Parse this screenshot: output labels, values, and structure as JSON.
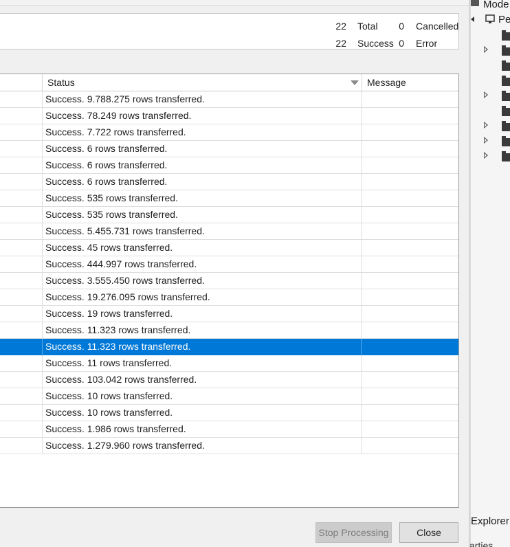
{
  "summary": {
    "total_count": "22",
    "total_label": "Total",
    "cancelled_count": "0",
    "cancelled_label": "Cancelled",
    "success_count": "22",
    "success_label": "Success",
    "error_count": "0",
    "error_label": "Error"
  },
  "grid": {
    "columns": [
      "",
      "Status",
      "Message"
    ],
    "rows": [
      {
        "status": "Success. 9.788.275 rows transferred.",
        "message": ""
      },
      {
        "status": "Success. 78.249 rows transferred.",
        "message": ""
      },
      {
        "status": "Success. 7.722 rows transferred.",
        "message": ""
      },
      {
        "status": "Success. 6 rows transferred.",
        "message": ""
      },
      {
        "status": "Success. 6 rows transferred.",
        "message": ""
      },
      {
        "status": "Success. 6 rows transferred.",
        "message": ""
      },
      {
        "status": "Success. 535 rows transferred.",
        "message": ""
      },
      {
        "status": "Success. 535 rows transferred.",
        "message": ""
      },
      {
        "status": "Success. 5.455.731 rows transferred.",
        "message": ""
      },
      {
        "status": "Success. 45 rows transferred.",
        "message": ""
      },
      {
        "status": "Success. 444.997 rows transferred.",
        "message": ""
      },
      {
        "status": "Success. 3.555.450 rows transferred.",
        "message": ""
      },
      {
        "status": "Success. 19.276.095 rows transferred.",
        "message": ""
      },
      {
        "status": "Success. 19 rows transferred.",
        "message": ""
      },
      {
        "status": "Success. 11.323 rows transferred.",
        "message": ""
      },
      {
        "status": "Success. 11.323 rows transferred.",
        "message": "",
        "selected": true
      },
      {
        "status": "Success. 11 rows transferred.",
        "message": ""
      },
      {
        "status": "Success. 103.042 rows transferred.",
        "message": ""
      },
      {
        "status": "Success. 10 rows transferred.",
        "message": ""
      },
      {
        "status": "Success. 10 rows transferred.",
        "message": ""
      },
      {
        "status": "Success. 1.986 rows transferred.",
        "message": ""
      },
      {
        "status": "Success. 1.279.960 rows transferred.",
        "message": ""
      }
    ]
  },
  "buttons": {
    "stop_label": "Stop Processing",
    "close_label": "Close"
  },
  "side_panel": {
    "title": "Mode",
    "sub_item": "Pe",
    "explorer_label": "Explorer",
    "properties_label": "arties",
    "expanders": [
      true,
      false,
      false,
      true,
      false,
      true,
      true,
      true,
      false
    ]
  },
  "colors": {
    "selection": "#0078d7",
    "accent_text": "#ffffff"
  }
}
